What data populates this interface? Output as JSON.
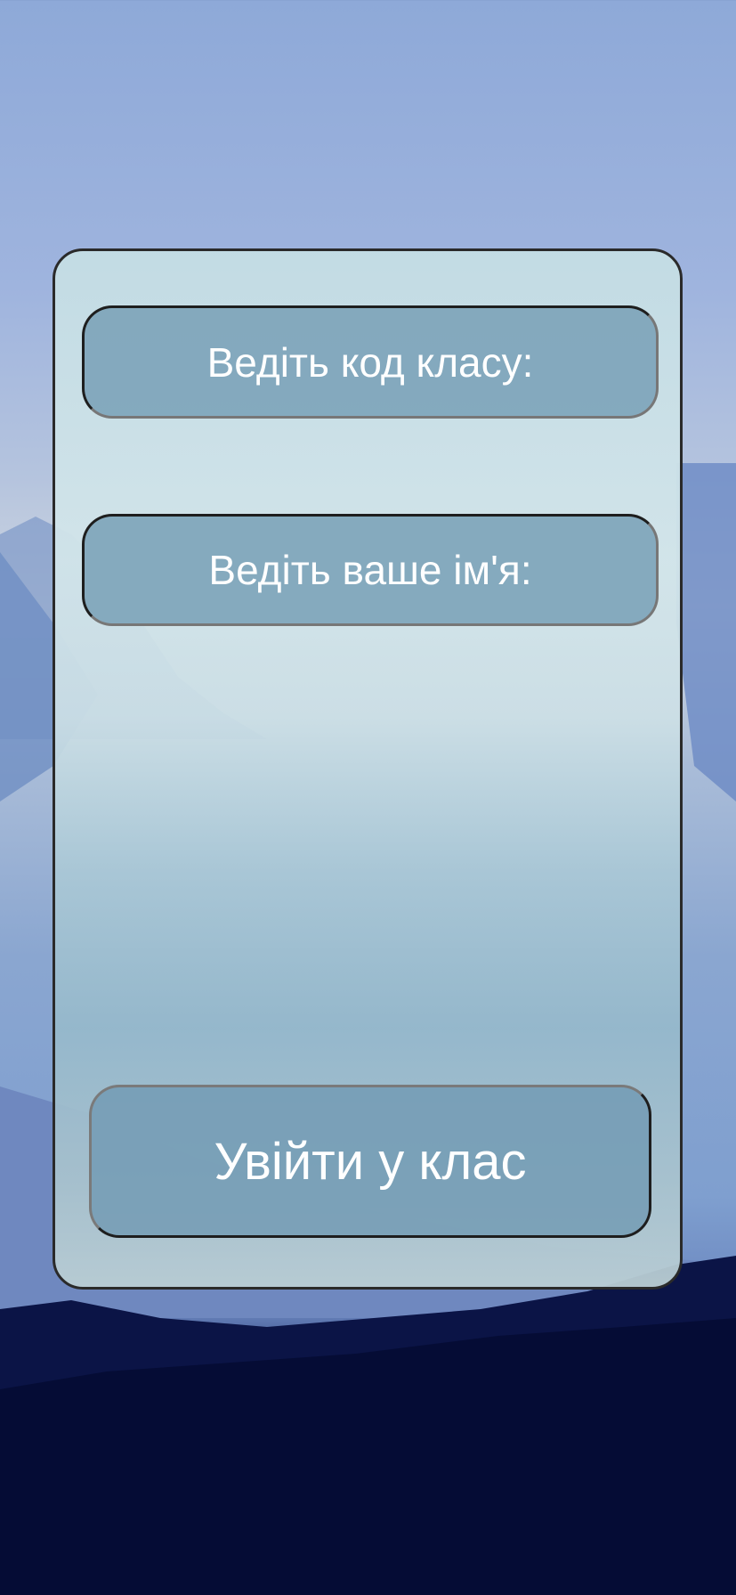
{
  "form": {
    "class_code_placeholder": "Ведіть код класу:",
    "name_placeholder": "Ведіть ваше ім'я:",
    "enter_button_label": "Увійти у клас"
  },
  "colors": {
    "card_background": "#c9dfe5",
    "field_background": "#7fa3b9",
    "text": "#ffffff"
  }
}
